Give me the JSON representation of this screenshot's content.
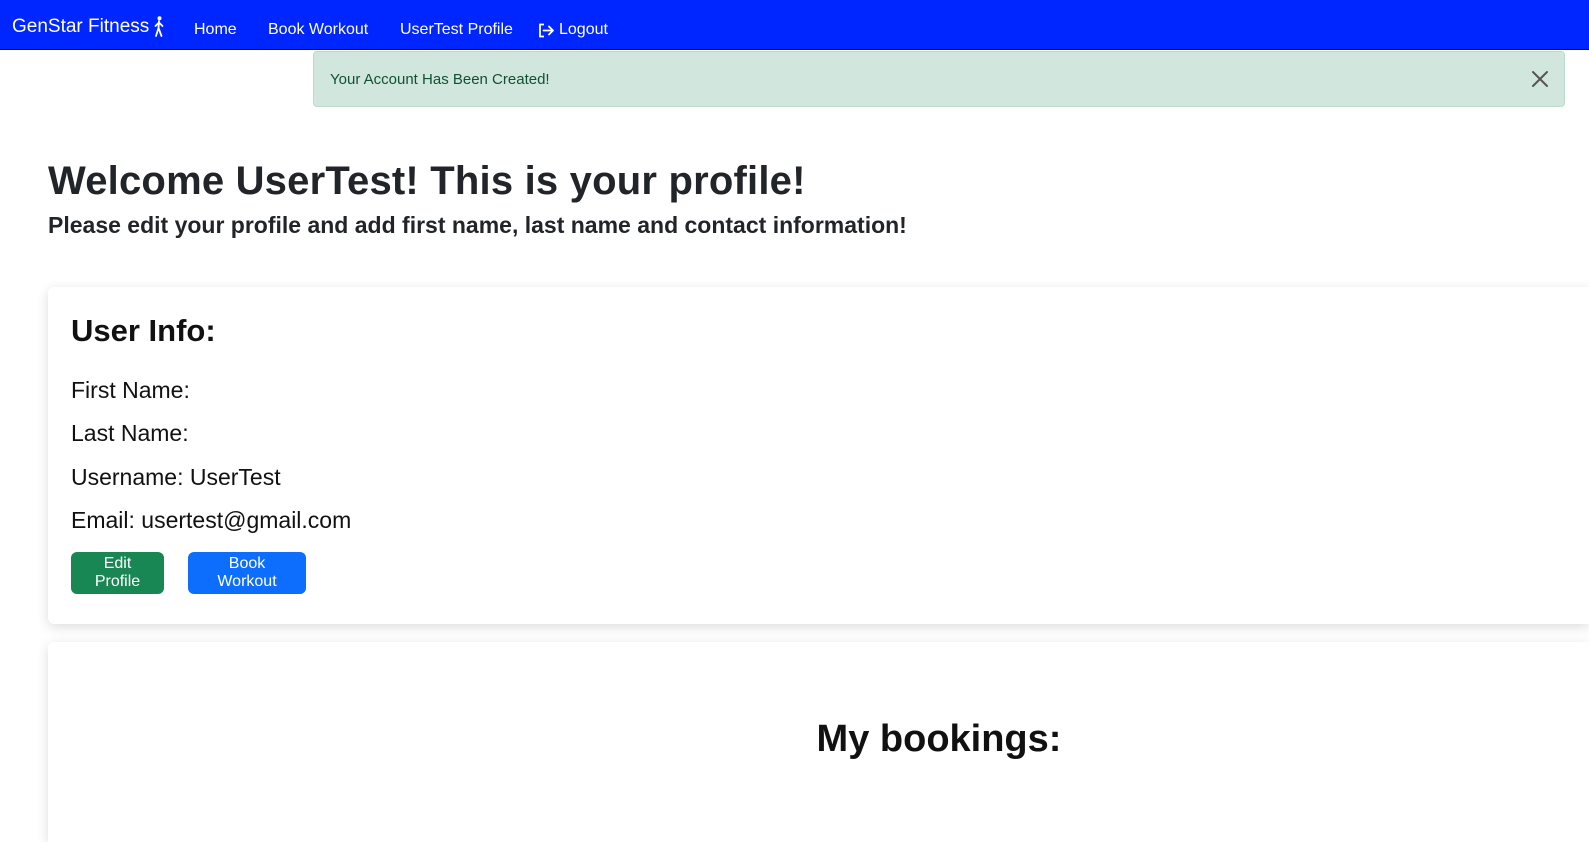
{
  "navbar": {
    "brand": "GenStar Fitness",
    "brand_icon": "walking-person-icon",
    "links": [
      {
        "label": "Home"
      },
      {
        "label": "Book Workout"
      },
      {
        "label": "UserTest Profile"
      },
      {
        "label": "Logout",
        "icon": "logout-icon"
      }
    ],
    "background": "#0026ff"
  },
  "alert": {
    "message": "Your Account Has Been Created!",
    "close_icon": "close-icon",
    "background": "#d1e7dd"
  },
  "header": {
    "title": "Welcome UserTest! This is your profile!",
    "subtitle": "Please edit your profile and add first name, last name and contact information!"
  },
  "user_info": {
    "title": "User Info:",
    "first_name": "First Name:",
    "last_name": "Last Name:",
    "username": "Username: UserTest",
    "email": "Email: usertest@gmail.com",
    "edit_button": "Edit Profile",
    "book_button": "Book Workout",
    "edit_color": "#198754",
    "book_color": "#0d6efd"
  },
  "bookings": {
    "title": "My bookings:"
  }
}
